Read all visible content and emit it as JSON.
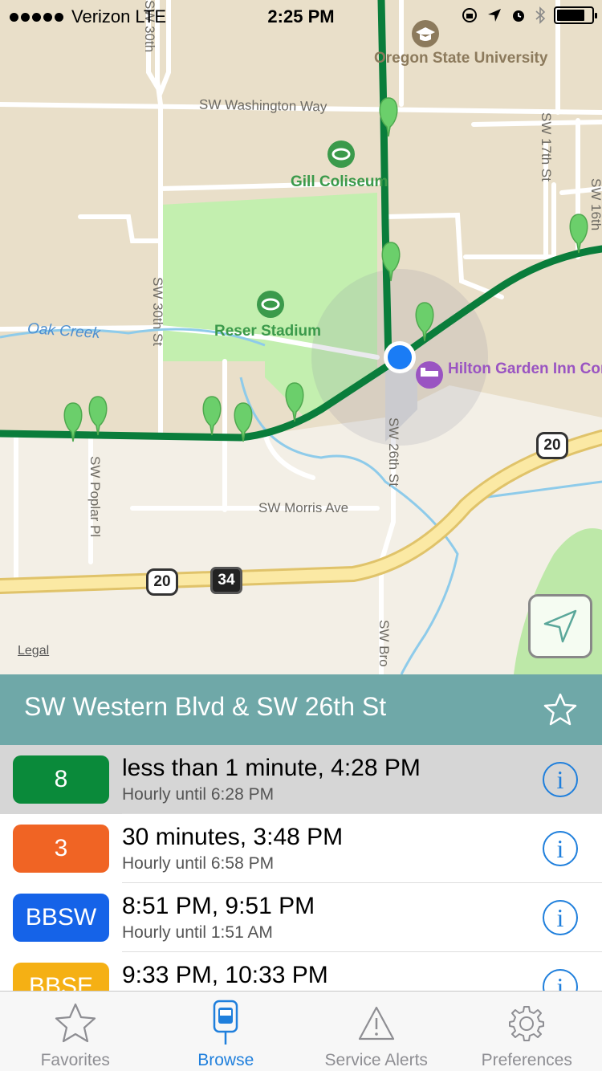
{
  "status_bar": {
    "carrier": "Verizon",
    "network": "LTE",
    "time": "2:25 PM",
    "icons": [
      "rotation-lock-icon",
      "location-arrow-icon",
      "alarm-icon",
      "bluetooth-icon",
      "battery-icon"
    ]
  },
  "map": {
    "streets": {
      "washington": "SW Washington Way",
      "st_30th": "SW 30th St",
      "st_30th_top": "SW 30th",
      "st_17th": "SW 17th St",
      "st_16th": "SW 16th",
      "st_26th": "SW 26th St",
      "morris": "SW Morris Ave",
      "poplar": "SW Poplar Pl",
      "broadway": "SW Bro",
      "western": "SW Western Blvd"
    },
    "pois": {
      "osu": "Oregon State University",
      "coliseum": "Gill Coliseum",
      "stadium": "Reser Stadium",
      "hotel": "Hilton Garden Inn Corvallis"
    },
    "water": {
      "creek": "Oak Creek"
    },
    "highways": {
      "us20_a": "20",
      "us20_b": "20",
      "or34": "34"
    },
    "legal_label": "Legal",
    "colors": {
      "route_line": "#0a7d3b",
      "stop_pin": "#6bcf6b",
      "user_location": "#1a7cf5",
      "park": "#c3efaf"
    }
  },
  "stop": {
    "title": "SW Western Blvd & SW 26th St",
    "favorite_icon": "star-outline-icon"
  },
  "arrivals": [
    {
      "route": "8",
      "color": "#0a8a3a",
      "time": "less than 1 minute, 4:28 PM",
      "schedule": "Hourly until 6:28 PM",
      "selected": true
    },
    {
      "route": "3",
      "color": "#f06424",
      "time": "30 minutes, 3:48 PM",
      "schedule": "Hourly until 6:58 PM",
      "selected": false
    },
    {
      "route": "BBSW",
      "color": "#1563e8",
      "time": "8:51 PM, 9:51 PM",
      "schedule": "Hourly until 1:51 AM",
      "selected": false
    },
    {
      "route": "BBSE",
      "color": "#f5b014",
      "time": "9:33 PM, 10:33 PM",
      "schedule": "",
      "selected": false
    }
  ],
  "tabs": [
    {
      "label": "Favorites",
      "icon": "star-icon",
      "active": false
    },
    {
      "label": "Browse",
      "icon": "bus-stop-icon",
      "active": true
    },
    {
      "label": "Service Alerts",
      "icon": "warning-icon",
      "active": false
    },
    {
      "label": "Preferences",
      "icon": "gear-icon",
      "active": false
    }
  ]
}
